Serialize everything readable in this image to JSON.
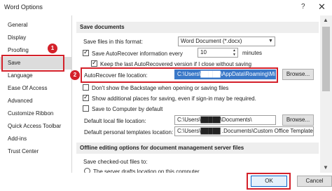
{
  "window": {
    "title": "Word Options",
    "help_glyph": "?",
    "close_glyph": "✕"
  },
  "sidebar": {
    "items": [
      {
        "label": "General"
      },
      {
        "label": "Display"
      },
      {
        "label": "Proofing"
      },
      {
        "label": "Save"
      },
      {
        "label": "Language"
      },
      {
        "label": "Ease Of Access"
      },
      {
        "label": "Advanced"
      },
      {
        "label": "Customize Ribbon"
      },
      {
        "label": "Quick Access Toolbar"
      },
      {
        "label": "Add-ins"
      },
      {
        "label": "Trust Center"
      }
    ],
    "selected": "Save"
  },
  "badges": {
    "one": "1",
    "two": "2"
  },
  "save_documents": {
    "header": "Save documents",
    "format_label": "Save files in this format:",
    "format_value": "Word Document (*.docx)",
    "autorecover_label": "Save AutoRecover information every",
    "autorecover_minutes": "10",
    "minutes_label": "minutes",
    "keep_last_label": "Keep the last AutoRecovered version if I close without saving",
    "autorecover_location_label": "AutoRecover file location:",
    "autorecover_location_value": "C:\\Users\\█████\\AppData\\Roaming\\Mic",
    "browse_label": "Browse...",
    "backstage_label": "Don't show the Backstage when opening or saving files",
    "additional_places_label": "Show additional places for saving, even if sign-in may be required.",
    "save_computer_label": "Save to Computer by default",
    "default_local_label": "Default local file location:",
    "default_local_value": "C:\\Users\\█████\\Documents\\",
    "browse2_label": "Browse...",
    "default_templates_label": "Default personal templates location:",
    "default_templates_value": "C:\\Users\\█████ .Documents\\Custom Office Templates\\"
  },
  "offline": {
    "header": "Offline editing options for document management server files",
    "checked_out_label": "Save checked-out files to:",
    "server_drafts_label": "The server drafts location on this computer"
  },
  "footer": {
    "ok_label": "OK",
    "cancel_label": "Cancel"
  }
}
